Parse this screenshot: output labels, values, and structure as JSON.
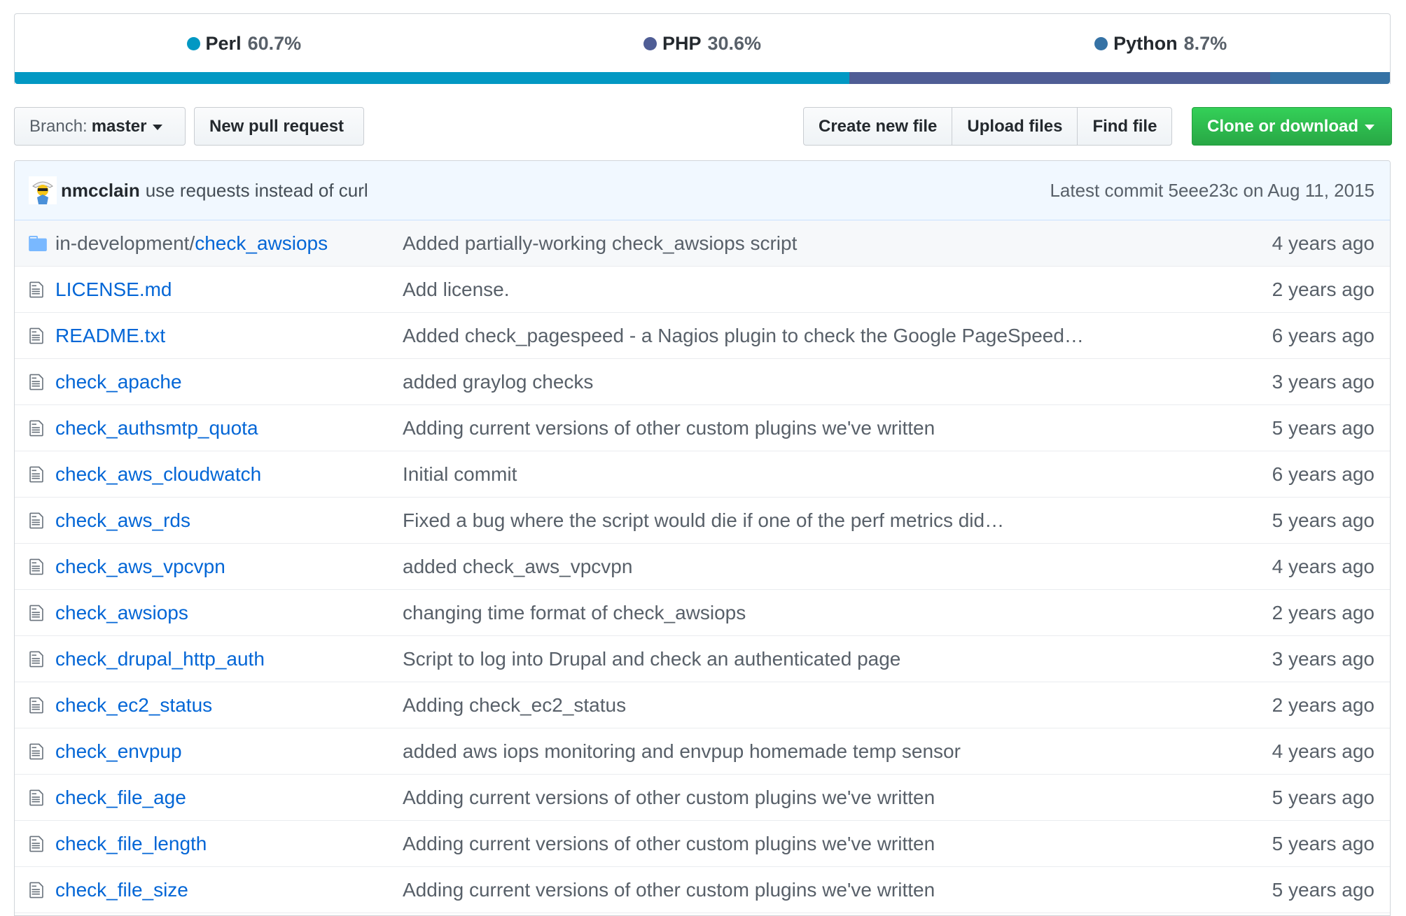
{
  "languages": [
    {
      "name": "Perl",
      "percent": "60.7%",
      "color": "#0298c3",
      "fraction": 0.607
    },
    {
      "name": "PHP",
      "percent": "30.6%",
      "color": "#4f5d95",
      "fraction": 0.306
    },
    {
      "name": "Python",
      "percent": "8.7%",
      "color": "#3572a5",
      "fraction": 0.087
    }
  ],
  "toolbar": {
    "branch_prefix": "Branch:",
    "branch_name": "master",
    "new_pull_request": "New pull request",
    "create_new_file": "Create new file",
    "upload_files": "Upload files",
    "find_file": "Find file",
    "clone_or_download": "Clone or download"
  },
  "latest_commit": {
    "author": "nmcclain",
    "message": "use requests instead of curl",
    "label": "Latest commit",
    "sha": "5eee23c",
    "date_prefix": "on",
    "date": "Aug 11, 2015"
  },
  "files": [
    {
      "type": "dir",
      "prefix": "in-development/",
      "name": "check_awsiops",
      "message": "Added partially-working check_awsiops script",
      "age": "4 years ago"
    },
    {
      "type": "file",
      "prefix": "",
      "name": "LICENSE.md",
      "message": "Add license.",
      "age": "2 years ago"
    },
    {
      "type": "file",
      "prefix": "",
      "name": "README.txt",
      "message": "Added check_pagespeed - a Nagios plugin to check the Google PageSpeed…",
      "age": "6 years ago"
    },
    {
      "type": "file",
      "prefix": "",
      "name": "check_apache",
      "message": "added graylog checks",
      "age": "3 years ago"
    },
    {
      "type": "file",
      "prefix": "",
      "name": "check_authsmtp_quota",
      "message": "Adding current versions of other custom plugins we've written",
      "age": "5 years ago"
    },
    {
      "type": "file",
      "prefix": "",
      "name": "check_aws_cloudwatch",
      "message": "Initial commit",
      "age": "6 years ago"
    },
    {
      "type": "file",
      "prefix": "",
      "name": "check_aws_rds",
      "message": "Fixed a bug where the script would die if one of the perf metrics did…",
      "age": "5 years ago"
    },
    {
      "type": "file",
      "prefix": "",
      "name": "check_aws_vpcvpn",
      "message": "added check_aws_vpcvpn",
      "age": "4 years ago"
    },
    {
      "type": "file",
      "prefix": "",
      "name": "check_awsiops",
      "message": "changing time format of check_awsiops",
      "age": "2 years ago"
    },
    {
      "type": "file",
      "prefix": "",
      "name": "check_drupal_http_auth",
      "message": "Script to log into Drupal and check an authenticated page",
      "age": "3 years ago"
    },
    {
      "type": "file",
      "prefix": "",
      "name": "check_ec2_status",
      "message": "Adding check_ec2_status",
      "age": "2 years ago"
    },
    {
      "type": "file",
      "prefix": "",
      "name": "check_envpup",
      "message": "added aws iops monitoring and envpup homemade temp sensor",
      "age": "4 years ago"
    },
    {
      "type": "file",
      "prefix": "",
      "name": "check_file_age",
      "message": "Adding current versions of other custom plugins we've written",
      "age": "5 years ago"
    },
    {
      "type": "file",
      "prefix": "",
      "name": "check_file_length",
      "message": "Adding current versions of other custom plugins we've written",
      "age": "5 years ago"
    },
    {
      "type": "file",
      "prefix": "",
      "name": "check_file_size",
      "message": "Adding current versions of other custom plugins we've written",
      "age": "5 years ago"
    }
  ]
}
